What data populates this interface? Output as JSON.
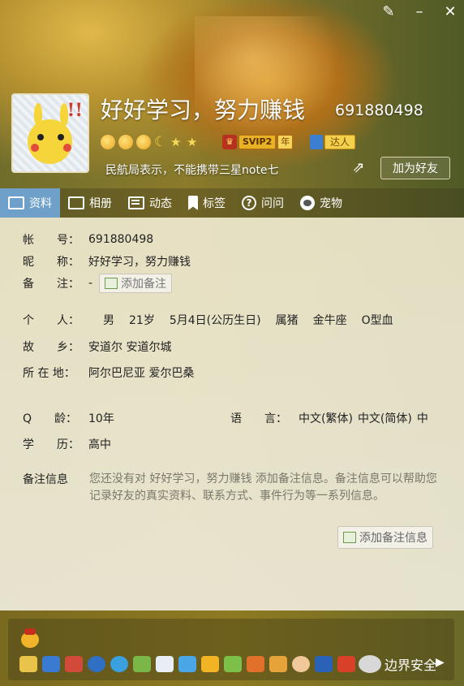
{
  "profile": {
    "nickname": "好好学习，努力赚钱",
    "qq_number": "691880498",
    "signature": "民航局表示，不能携带三星note七",
    "add_friend_label": "加为好友",
    "svip_label": "SVIP2",
    "svip_year_label": "年",
    "daren_label": "达人",
    "avatar_text": "!!"
  },
  "window": {
    "controls": [
      "brush-icon",
      "minimize-icon",
      "close-icon"
    ]
  },
  "tabs": [
    {
      "label": "资料",
      "icon": "profile-card-icon"
    },
    {
      "label": "相册",
      "icon": "photo-album-icon"
    },
    {
      "label": "动态",
      "icon": "feed-list-icon"
    },
    {
      "label": "标签",
      "icon": "bookmark-icon"
    },
    {
      "label": "问问",
      "icon": "question-icon"
    },
    {
      "label": "宠物",
      "icon": "pet-icon"
    }
  ],
  "info": {
    "account_label": "帐　　号：",
    "account_value": "691880498",
    "nick_label": "昵　　称：",
    "nick_value": "好好学习，努力赚钱",
    "remark_label": "备　　注：",
    "remark_value": "-",
    "add_remark_label": "添加备注",
    "personal_label": "个　　人：",
    "gender": "男",
    "age": "21岁",
    "birthday": "5月4日(公历生日)",
    "zodiac": "属猪",
    "star_sign": "金牛座",
    "blood": "O型血",
    "hometown_label": "故　　乡：",
    "hometown_value": "安道尔 安道尔城",
    "location_label": "所 在 地：",
    "location_value": "阿尔巴尼亚 爱尔巴桑",
    "qage_label": "Q　　龄：",
    "qage_value": "10年",
    "language_label": "语　　言：",
    "language_values": [
      "中文(繁体)",
      "中文(简体)",
      "中"
    ],
    "education_label": "学　　历：",
    "education_value": "高中",
    "note_info_label": "备注信息",
    "note_info_text": "您还没有对 好好学习，努力赚钱 添加备注信息。备注信息可以帮助您记录好友的真实资料、联系方式、事件行为等一系列信息。",
    "add_note_info_label": "添加备注信息"
  },
  "watermark": {
    "text": "边界安全"
  },
  "colors": {
    "active_tab": "#6fa0c9",
    "text": "#222222",
    "hint": "#7a786b"
  }
}
